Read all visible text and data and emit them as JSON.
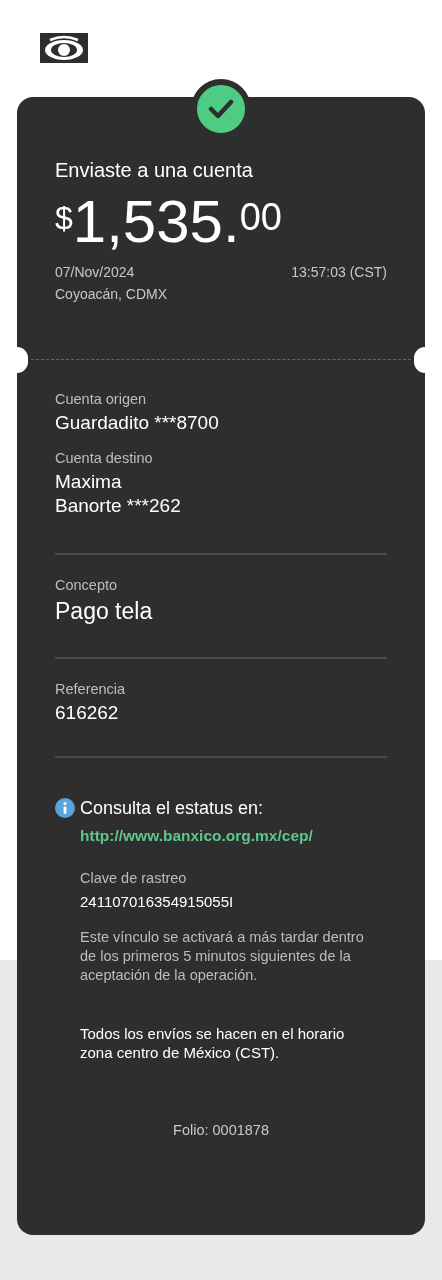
{
  "status": {
    "kind": "success"
  },
  "header": {
    "title": "Enviaste a una cuenta",
    "currency": "$",
    "amount": "1,535.",
    "cents": "00",
    "date": "07/Nov/2024",
    "time": "13:57:03 (CST)",
    "location": "Coyoacán, CDMX"
  },
  "sections": [
    {
      "fields": [
        {
          "label": "Cuenta origen",
          "lines": [
            "Guardadito ***8700"
          ],
          "kind": "normal"
        },
        {
          "label": "Cuenta destino",
          "lines": [
            "Maxima",
            "Banorte ***262"
          ],
          "kind": "normal"
        }
      ]
    },
    {
      "fields": [
        {
          "label": "Concepto",
          "lines": [
            "Pago tela"
          ],
          "kind": "large"
        }
      ]
    },
    {
      "fields": [
        {
          "label": "Referencia",
          "lines": [
            "616262"
          ],
          "kind": "normal"
        }
      ]
    }
  ],
  "info": {
    "title": "Consulta el estatus en:",
    "link": "http://www.banxico.org.mx/cep/",
    "tracking_label": "Clave de rastreo",
    "tracking_value": "241107016354915055I",
    "notice": "Este vínculo se activará a más tardar dentro de los primeros 5 minutos siguientes de la aceptación de la operación.",
    "timezone_note": "Todos los envíos se hacen en el horario zona centro de México (CST)."
  },
  "folio": "Folio: 0001878"
}
